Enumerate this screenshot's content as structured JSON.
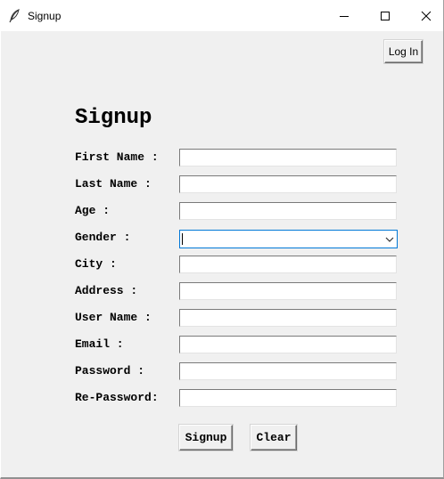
{
  "window": {
    "title": "Signup",
    "controls": {
      "minimize": "minimize-icon",
      "maximize": "maximize-icon",
      "close": "close-icon"
    }
  },
  "toolbar": {
    "login_label": "Log In"
  },
  "form": {
    "heading": "Signup",
    "fields": [
      {
        "label": "First Name :",
        "value": ""
      },
      {
        "label": "Last Name :",
        "value": ""
      },
      {
        "label": "Age :",
        "value": ""
      },
      {
        "label": "Gender :",
        "value": "",
        "type": "combobox"
      },
      {
        "label": "City :",
        "value": ""
      },
      {
        "label": "Address :",
        "value": ""
      },
      {
        "label": "User Name :",
        "value": ""
      },
      {
        "label": "Email :",
        "value": ""
      },
      {
        "label": "Password :",
        "value": ""
      },
      {
        "label": "Re-Password:",
        "value": ""
      }
    ],
    "signup_label": "Signup",
    "clear_label": "Clear"
  },
  "colors": {
    "background": "#f0f0f0",
    "focus_border": "#0078d7"
  }
}
